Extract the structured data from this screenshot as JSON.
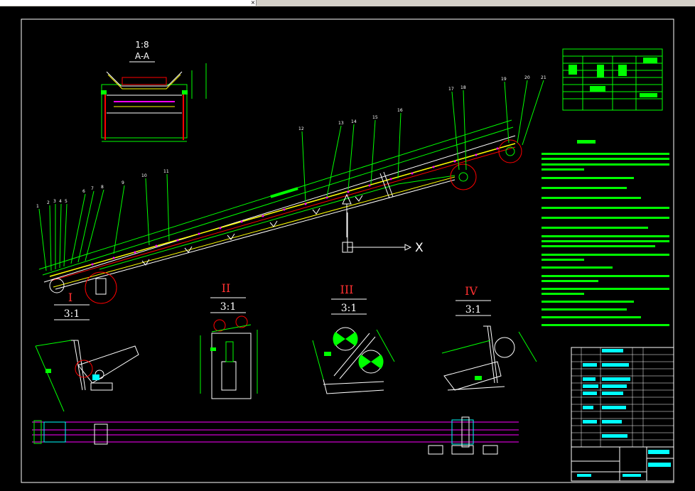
{
  "window": {
    "close_glyph": "×"
  },
  "section_view": {
    "scale": "1:8",
    "label": "A-A"
  },
  "details": [
    {
      "numeral": "I",
      "scale": "3:1"
    },
    {
      "numeral": "II",
      "scale": "3:1"
    },
    {
      "numeral": "III",
      "scale": "3:1"
    },
    {
      "numeral": "IV",
      "scale": "3:1"
    }
  ],
  "ucs": {
    "x_label": "X"
  },
  "part_numbers": [
    "1",
    "2",
    "3",
    "4",
    "5",
    "6",
    "7",
    "8",
    "9",
    "10",
    "11",
    "12",
    "13",
    "14",
    "15",
    "16",
    "17",
    "18",
    "19",
    "20",
    "21"
  ],
  "colors": {
    "background": "#000000",
    "frame": "#ffffff",
    "geometry": "#00ff00",
    "belt": "#ffff00",
    "highlight": "#ff00ff",
    "accent": "#00ffff",
    "warning": "#ff0000"
  }
}
